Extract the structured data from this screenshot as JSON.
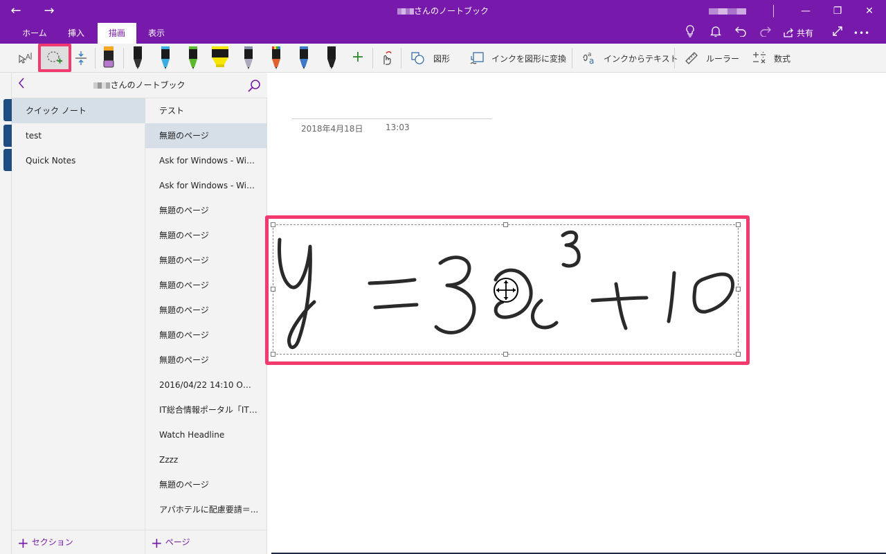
{
  "titlebar": {
    "title_suffix": "さんのノートブック",
    "back_icon": "back-arrow-icon",
    "forward_icon": "forward-arrow-icon",
    "minimize": "—",
    "restore": "❐",
    "close": "✕"
  },
  "tabs": [
    {
      "label": "ホーム",
      "active": false
    },
    {
      "label": "挿入",
      "active": false
    },
    {
      "label": "描画",
      "active": true
    },
    {
      "label": "表示",
      "active": false
    }
  ],
  "tab_icons": [
    "lightbulb-icon",
    "bell-icon",
    "undo-icon",
    "redo-icon"
  ],
  "share_label": "共有",
  "more_label": "•••",
  "ribbon": {
    "pens": [
      {
        "name": "highlighter-orange-purple",
        "color": "#f5a623",
        "cap": "#b57acd"
      },
      {
        "name": "pen-black",
        "color": "#222"
      },
      {
        "name": "pen-cyan",
        "color": "#3aaee0"
      },
      {
        "name": "pen-green",
        "color": "#5cb82c"
      },
      {
        "name": "highlighter-yellow",
        "color": "#f7e600"
      },
      {
        "name": "pen-galaxy",
        "color": "#8a8fa8"
      },
      {
        "name": "pen-rainbow",
        "color": "#e0602e"
      },
      {
        "name": "pen-blue-galaxy",
        "color": "#3f78c9"
      },
      {
        "name": "pen-black-2",
        "color": "#222"
      }
    ],
    "add_pen": "+",
    "shapes_label": "図形",
    "ink_to_shape_label": "インクを図形に変換",
    "ink_to_text_label": "インクからテキスト",
    "ruler_label": "ルーラー",
    "math_label": "数式",
    "accent_color": "#7719aa",
    "highlight_color": "#f33a6f"
  },
  "notebook": {
    "title_suffix": "さんのノートブック",
    "sections": [
      {
        "label": "クイック ノート",
        "selected": true
      },
      {
        "label": "test",
        "selected": false
      },
      {
        "label": "Quick Notes",
        "selected": false
      }
    ],
    "pages": [
      {
        "label": "テスト",
        "selected": false
      },
      {
        "label": "無題のページ",
        "selected": true
      },
      {
        "label": "Ask for Windows - Win...",
        "selected": false
      },
      {
        "label": "Ask for Windows - Win...",
        "selected": false
      },
      {
        "label": "無題のページ",
        "selected": false
      },
      {
        "label": "無題のページ",
        "selected": false
      },
      {
        "label": "無題のページ",
        "selected": false
      },
      {
        "label": "無題のページ",
        "selected": false
      },
      {
        "label": "無題のページ",
        "selected": false
      },
      {
        "label": "無題のページ",
        "selected": false
      },
      {
        "label": "無題のページ",
        "selected": false
      },
      {
        "label": "2016/04/22 14:10 Offic...",
        "selected": false
      },
      {
        "label": "IT総合情報ポータル「ITm...",
        "selected": false
      },
      {
        "label": "Watch Headline",
        "selected": false
      },
      {
        "label": "Zzzz",
        "selected": false
      },
      {
        "label": "無題のページ",
        "selected": false
      },
      {
        "label": "アパホテルに配慮要請＝...",
        "selected": false
      }
    ],
    "add_section_label": "セクション",
    "add_page_label": "ページ"
  },
  "canvas": {
    "date": "2018年4月18日",
    "time": "13:03"
  }
}
